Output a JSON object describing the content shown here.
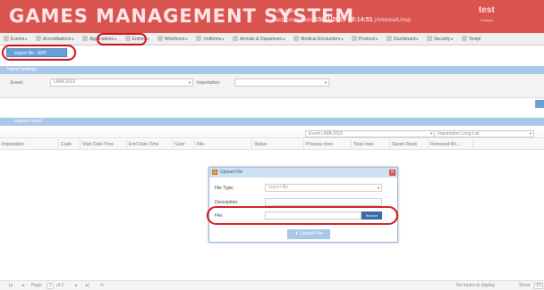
{
  "header": {
    "title": "GAMES MANAGEMENT SYSTEM",
    "user": "User: jlopez",
    "last_connection_label": "Last Connection:",
    "last_connection_value": "15/01/2019 09:14:51",
    "timezone": "(America/Lima)",
    "app_name": "test",
    "session": "Session",
    "brand_color": "#d9534f"
  },
  "menu": [
    {
      "label": "Events",
      "icon": "events-icon"
    },
    {
      "label": "Accreditations",
      "icon": "accreditations-icon"
    },
    {
      "label": "Applications",
      "icon": "applications-icon"
    },
    {
      "label": "Entries",
      "icon": "entries-icon"
    },
    {
      "label": "Workforce",
      "icon": "workforce-icon"
    },
    {
      "label": "Uniforms",
      "icon": "uniforms-icon"
    },
    {
      "label": "Arrivals & Departures",
      "icon": "plane-icon"
    },
    {
      "label": "Medical Encounters",
      "icon": "medical-icon"
    },
    {
      "label": "Protocol",
      "icon": "protocol-icon"
    },
    {
      "label": "Dashboard",
      "icon": "dashboard-icon"
    },
    {
      "label": "Security",
      "icon": "security-icon"
    },
    {
      "label": "Templ",
      "icon": "template-icon"
    }
  ],
  "import_button": "Import file - APP",
  "import_settings": {
    "section_title": "Import settings",
    "event_label": "Event:",
    "event_value": "LIMA 2019",
    "importation_label": "Importation:",
    "importation_value": ""
  },
  "imports_found": {
    "section_title": "Imports found",
    "event_filter": "Event LIMA 2019",
    "importation_filter": "Importation Long List",
    "columns": [
      "Importation",
      "Code",
      "Start Date-Time",
      "End Date-Time",
      "User",
      "File",
      "Status",
      "Process rows",
      "Total rows",
      "Saved Rows",
      "Removed Ro..."
    ]
  },
  "pager": {
    "page_label": "Page",
    "page_value": "1",
    "of_label": "of 1",
    "no_topics": "No topics to display",
    "show_label": "Show",
    "show_value": "10"
  },
  "dialog": {
    "title": "Upload File",
    "close": "✕",
    "file_type_label": "File Type:",
    "file_type_placeholder": "Import file",
    "description_label": "Description:",
    "file_label": "File:",
    "browse": "Browse",
    "upload": "Upload File"
  }
}
